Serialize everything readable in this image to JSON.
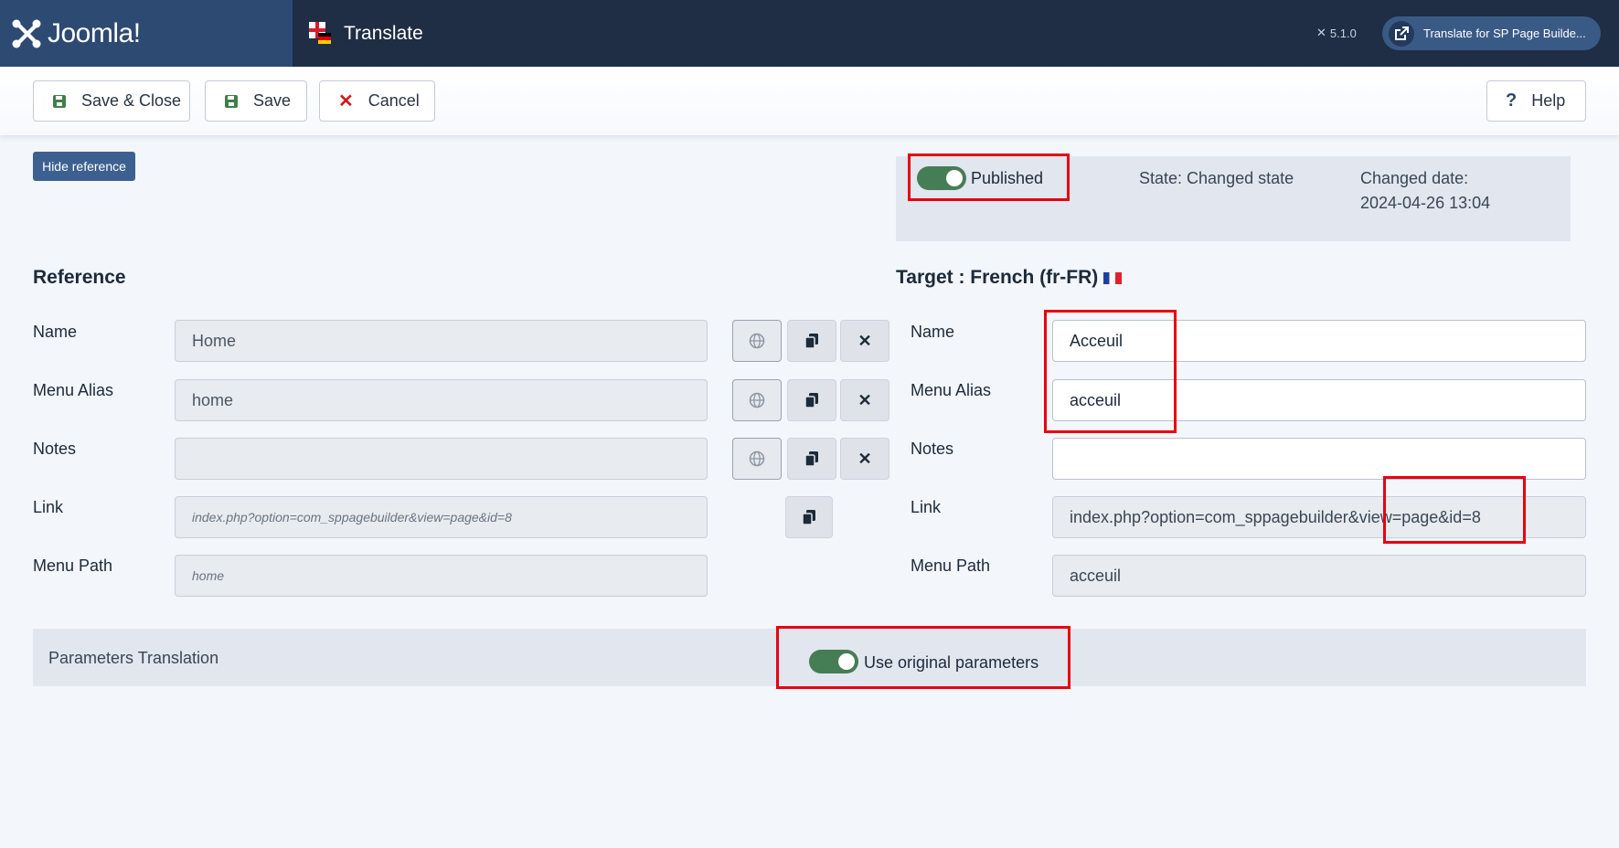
{
  "header": {
    "logo_text": "Joomla!",
    "page_title": "Translate",
    "version": "5.1.0",
    "external_button": "Translate for SP Page Builde..."
  },
  "toolbar": {
    "save_close": "Save & Close",
    "save": "Save",
    "cancel": "Cancel",
    "help": "Help"
  },
  "hide_reference": "Hide reference",
  "status": {
    "published_label": "Published",
    "published": true,
    "state": "State: Changed state",
    "changed_label": "Changed date:",
    "changed_value": "2024-04-26 13:04"
  },
  "reference": {
    "title": "Reference",
    "fields": {
      "name": {
        "label": "Name",
        "value": "Home"
      },
      "alias": {
        "label": "Menu Alias",
        "value": "home"
      },
      "notes": {
        "label": "Notes",
        "value": ""
      },
      "link": {
        "label": "Link",
        "value": "index.php?option=com_sppagebuilder&view=page&id=8"
      },
      "path": {
        "label": "Menu Path",
        "value": "home"
      }
    }
  },
  "target": {
    "title": "Target : French (fr-FR)",
    "fields": {
      "name": {
        "label": "Name",
        "value": "Acceuil"
      },
      "alias": {
        "label": "Menu Alias",
        "value": "acceuil"
      },
      "notes": {
        "label": "Notes",
        "value": ""
      },
      "link": {
        "label": "Link",
        "value": "index.php?option=com_sppagebuilder&view=page&id=8"
      },
      "path": {
        "label": "Menu Path",
        "value": "acceuil"
      }
    }
  },
  "params": {
    "label": "Parameters Translation",
    "use_original_label": "Use original parameters",
    "use_original": true
  },
  "colors": {
    "header_bg": "#1f2e45",
    "logo_bg": "#2d4a72",
    "toggle_on": "#457d54",
    "highlight": "#e8000f"
  }
}
